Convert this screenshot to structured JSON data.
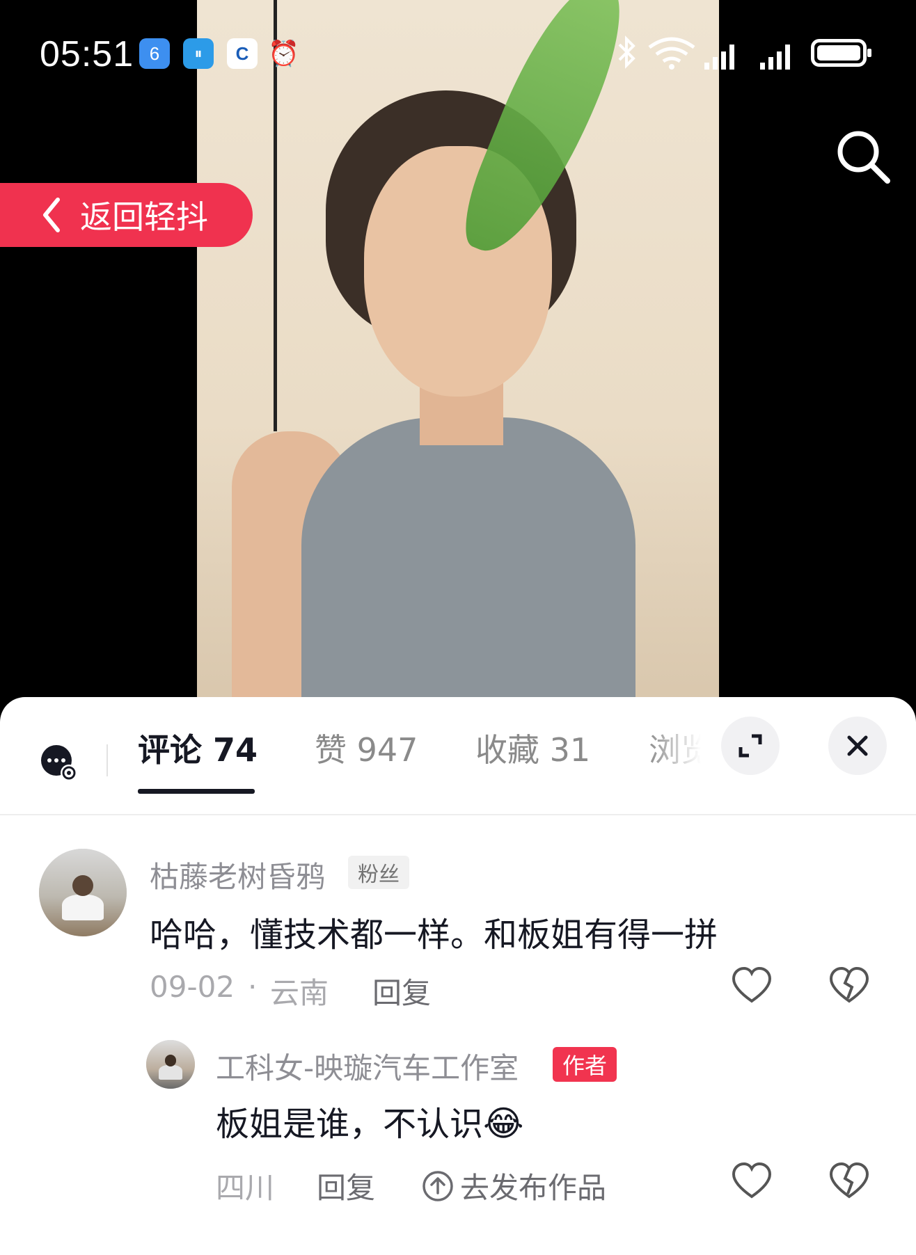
{
  "status_bar": {
    "time": "05:51",
    "apps": [
      {
        "icon": "app-6-icon",
        "glyph": "6",
        "color": "#3d8ff0"
      },
      {
        "icon": "app-pause-icon",
        "glyph": "⏸",
        "color": "#2c9be8"
      },
      {
        "icon": "app-c-icon",
        "glyph": "C",
        "color": "#ffffff"
      },
      {
        "icon": "alarm-icon",
        "glyph": "⏰"
      }
    ],
    "right_icons": [
      "bluetooth-icon",
      "wifi-icon",
      "signal-icon",
      "signal-icon",
      "battery-icon"
    ]
  },
  "video": {
    "back_button": {
      "label": "返回轻抖",
      "color": "#f0324f"
    },
    "search_icon": "search-icon"
  },
  "sheet": {
    "tabs": [
      {
        "label": "评论 74",
        "active": true
      },
      {
        "label": "赞 947",
        "active": false
      },
      {
        "label": "收藏 31",
        "active": false
      },
      {
        "label": "浏览",
        "active": false
      }
    ],
    "left_icon": "chat-settings-icon",
    "expand_icon": "expand-icon",
    "close_icon": "close-icon"
  },
  "comments": [
    {
      "username": "枯藤老树昏鸦",
      "badge": "粉丝",
      "text": "哈哈，懂技术都一样。和板姐有得一拼",
      "date": "09-02",
      "separator": "·",
      "location": "云南",
      "reply_label": "回复"
    },
    {
      "username": "工科女-映璇汽车工作室",
      "badge": "作者",
      "badge_color": "#f1344f",
      "text": "板姐是谁，不认识",
      "emoji": "😂",
      "location": "四川",
      "reply_label": "回复",
      "publish_label": "去发布作品"
    }
  ]
}
